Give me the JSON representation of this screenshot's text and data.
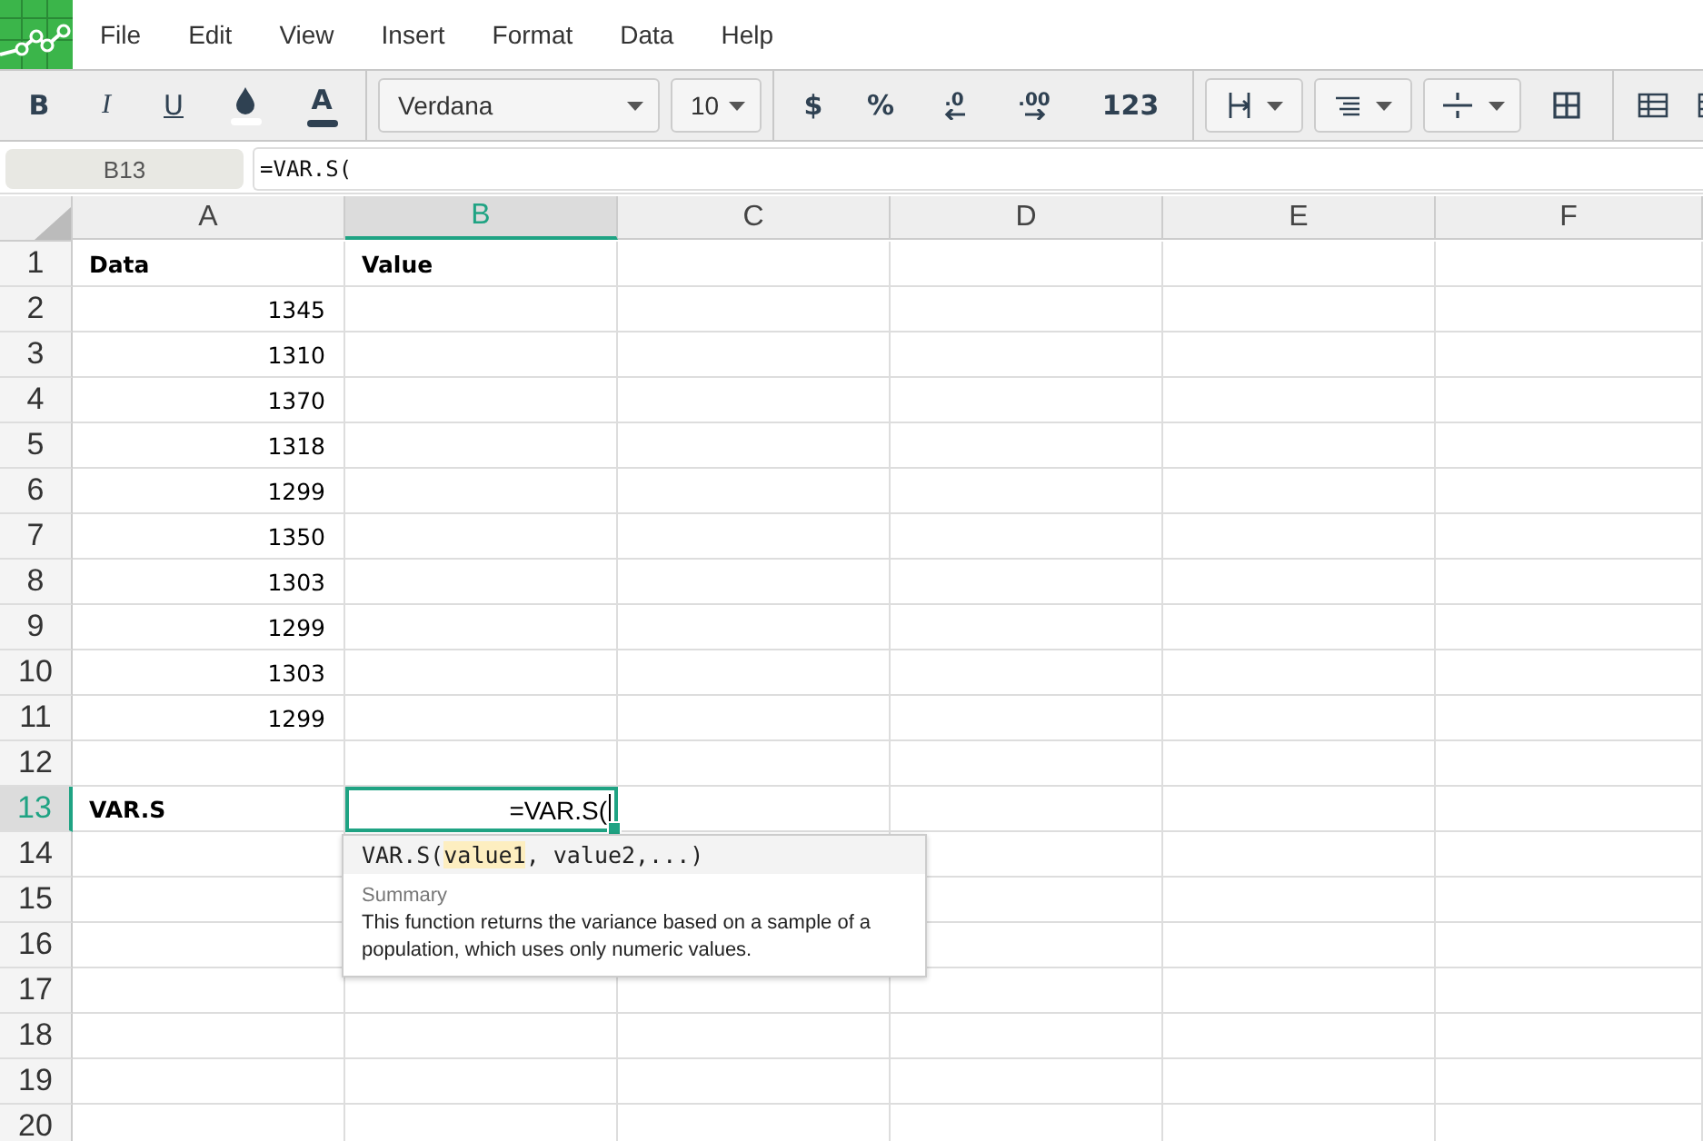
{
  "menu": [
    "File",
    "Edit",
    "View",
    "Insert",
    "Format",
    "Data",
    "Help"
  ],
  "toolbar": {
    "format_buttons": [
      {
        "kind": "bold",
        "label": "B"
      },
      {
        "kind": "italic",
        "label": "I"
      },
      {
        "kind": "underline",
        "label": "U"
      }
    ],
    "font_color_label": "A",
    "font": "Verdana",
    "size": "10",
    "number_buttons": [
      {
        "kind": "currency",
        "label": "$"
      },
      {
        "kind": "percent",
        "label": "%"
      },
      {
        "kind": "decrease-decimal",
        "label": ".0"
      },
      {
        "kind": "increase-decimal",
        "label": ".00"
      },
      {
        "kind": "number",
        "label": "123"
      }
    ]
  },
  "formula_bar": {
    "cell_ref": "B13",
    "value": "=VAR.S("
  },
  "columns": [
    {
      "label": "A",
      "selected": false
    },
    {
      "label": "B",
      "selected": true
    },
    {
      "label": "C",
      "selected": false
    },
    {
      "label": "D",
      "selected": false
    },
    {
      "label": "E",
      "selected": false
    },
    {
      "label": "F",
      "selected": false
    }
  ],
  "rows": [
    {
      "number": "1",
      "selected": false,
      "cells": [
        {
          "text": "Data",
          "kind": "label"
        },
        {
          "text": "Value",
          "kind": "label"
        }
      ]
    },
    {
      "number": "2",
      "selected": false,
      "cells": [
        {
          "text": "1345",
          "kind": "number"
        }
      ]
    },
    {
      "number": "3",
      "selected": false,
      "cells": [
        {
          "text": "1310",
          "kind": "number"
        }
      ]
    },
    {
      "number": "4",
      "selected": false,
      "cells": [
        {
          "text": "1370",
          "kind": "number"
        }
      ]
    },
    {
      "number": "5",
      "selected": false,
      "cells": [
        {
          "text": "1318",
          "kind": "number"
        }
      ]
    },
    {
      "number": "6",
      "selected": false,
      "cells": [
        {
          "text": "1299",
          "kind": "number"
        }
      ]
    },
    {
      "number": "7",
      "selected": false,
      "cells": [
        {
          "text": "1350",
          "kind": "number"
        }
      ]
    },
    {
      "number": "8",
      "selected": false,
      "cells": [
        {
          "text": "1303",
          "kind": "number"
        }
      ]
    },
    {
      "number": "9",
      "selected": false,
      "cells": [
        {
          "text": "1299",
          "kind": "number"
        }
      ]
    },
    {
      "number": "10",
      "selected": false,
      "cells": [
        {
          "text": "1303",
          "kind": "number"
        }
      ]
    },
    {
      "number": "11",
      "selected": false,
      "cells": [
        {
          "text": "1299",
          "kind": "number"
        }
      ]
    },
    {
      "number": "12",
      "selected": false
    },
    {
      "number": "13",
      "selected": true,
      "cells": [
        {
          "text": "VAR.S",
          "kind": "label"
        },
        {
          "text": "=VAR.S(",
          "kind": "editing"
        }
      ]
    },
    {
      "number": "14",
      "selected": false
    },
    {
      "number": "15",
      "selected": false
    },
    {
      "number": "16",
      "selected": false
    },
    {
      "number": "17",
      "selected": false
    },
    {
      "number": "18",
      "selected": false
    },
    {
      "number": "19",
      "selected": false
    },
    {
      "number": "20",
      "selected": false
    }
  ],
  "hint": {
    "signature": {
      "name": "VAR.S(",
      "active_arg": "value1",
      "rest": ", value2,...)"
    },
    "section": "Summary",
    "description": "This function returns the variance based on a sample of a population, which uses only numeric values."
  }
}
